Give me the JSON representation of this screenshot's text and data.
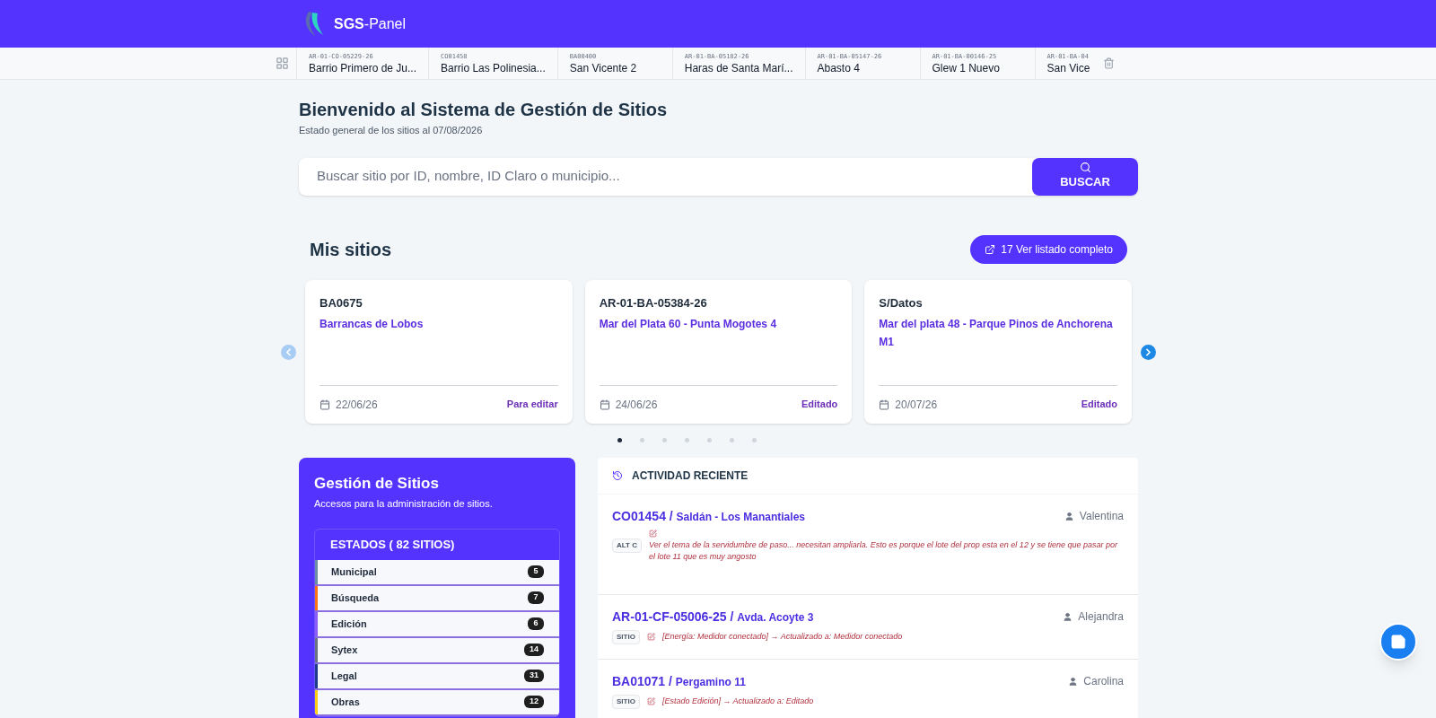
{
  "header": {
    "brand_bold": "SGS",
    "brand_rest": "-Panel"
  },
  "recent_tabs": [
    {
      "code": "AR-01-CO-05229-26",
      "name": "Barrio Primero de Ju..."
    },
    {
      "code": "CO01458",
      "name": "Barrio Las Polinesia..."
    },
    {
      "code": "BA00400",
      "name": "San Vicente 2"
    },
    {
      "code": "AR-01-BA-05182-26",
      "name": "Haras de Santa Marí..."
    },
    {
      "code": "AR-01-BA-05147-26",
      "name": "Abasto 4"
    },
    {
      "code": "AR-01-BA-00146-25",
      "name": "Glew 1 Nuevo"
    },
    {
      "code": "AR-01-BA-04",
      "name": "San Vice"
    }
  ],
  "welcome": {
    "title": "Bienvenido al Sistema de Gestión de Sitios",
    "subtitle": "Estado general de los sitios al 07/08/2026"
  },
  "search": {
    "placeholder": "Buscar sitio por ID, nombre, ID Claro o municipio...",
    "button": "BUSCAR"
  },
  "my_sites": {
    "title": "Mis sitios",
    "list_button": "17 Ver listado completo",
    "prev_disabled": true,
    "next_disabled": false,
    "cards": [
      {
        "id": "BA0675",
        "name": "Barrancas de Lobos",
        "date": "22/06/26",
        "status": "Para editar"
      },
      {
        "id": "AR-01-BA-05384-26",
        "name": "Mar del Plata 60 - Punta Mogotes 4",
        "date": "24/06/26",
        "status": "Editado"
      },
      {
        "id": "S/Datos",
        "name": "Mar del plata 48 - Parque Pinos de Anchorena M1",
        "date": "20/07/26",
        "status": "Editado"
      }
    ],
    "dots": [
      {
        "selected": true
      },
      {
        "selected": false
      },
      {
        "selected": false
      },
      {
        "selected": false
      },
      {
        "selected": false
      },
      {
        "selected": false
      },
      {
        "selected": false
      }
    ]
  },
  "management": {
    "title": "Gestión de Sitios",
    "subtitle": "Accesos para la administración de sitios.",
    "states_title": "ESTADOS ( 82 SITIOS)",
    "states": [
      {
        "label": "Municipal",
        "count": "5",
        "color": "#6b8ea3"
      },
      {
        "label": "Búsqueda",
        "count": "7",
        "color": "#f97316"
      },
      {
        "label": "Edición",
        "count": "6",
        "color": "#8b5cf6"
      },
      {
        "label": "Sytex",
        "count": "14",
        "color": "#6b7280"
      },
      {
        "label": "Legal",
        "count": "31",
        "color": "#1e3a8a"
      },
      {
        "label": "Obras",
        "count": "12",
        "color": "#facc15"
      }
    ]
  },
  "activity": {
    "title": "ACTIVIDAD RECIENTE",
    "separator": "/",
    "items": [
      {
        "id": "CO01454",
        "name": "Saldán - Los Manantiales",
        "user": "Valentina",
        "tag": "ALT C",
        "kind": "note",
        "text": "Ver el tema de la servidumbre de paso... necesitan ampliarla. Esto es porque el lote del prop esta en el 12 y se tiene que pasar por el lote 11 que es muy angosto"
      },
      {
        "id": "AR-01-CF-05006-25",
        "name": "Avda. Acoyte 3",
        "user": "Alejandra",
        "tag": "SITIO",
        "kind": "change",
        "text": "[Energía: Medidor conectado] → Actualizado a: Medidor conectado"
      },
      {
        "id": "BA01071",
        "name": "Pergamino 11",
        "user": "Carolina",
        "tag": "SITIO",
        "kind": "change",
        "text": "[Estado Edición] → Actualizado a: Editado"
      }
    ]
  }
}
